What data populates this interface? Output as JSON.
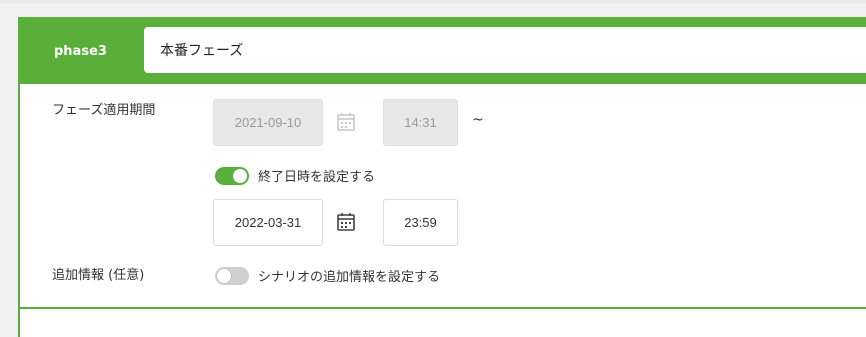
{
  "phase": {
    "id_label": "phase3",
    "name_value": "本番フェーズ"
  },
  "period": {
    "label": "フェーズ適用期間",
    "start_date": "2021-09-10",
    "start_time": "14:31",
    "separator": "~",
    "end_toggle_label": "終了日時を設定する",
    "end_toggle_on": true,
    "end_date": "2022-03-31",
    "end_time": "23:59"
  },
  "extra": {
    "label": "追加情報 (任意)",
    "toggle_label": "シナリオの追加情報を設定する",
    "toggle_on": false
  },
  "colors": {
    "accent": "#5aae3a",
    "disabled_bg": "#e8e8e8"
  },
  "icons": {
    "start_calendar": "calendar-icon",
    "end_calendar": "calendar-icon"
  }
}
